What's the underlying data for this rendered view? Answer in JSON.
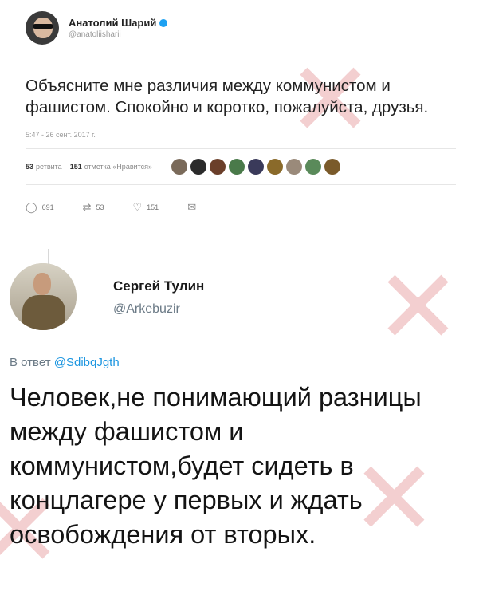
{
  "tweet1": {
    "author_name": "Анатолий Шарий",
    "handle": "@anatoliisharii",
    "text": "Объясните мне различия между коммунистом и фашистом. Спокойно и коротко, пожалуйста, друзья.",
    "timestamp": "5:47 - 26 сент. 2017 г.",
    "retweets_count": "53",
    "retweets_label": "ретвита",
    "likes_count": "151",
    "likes_label": "отметка «Нравится»",
    "actions": {
      "replies": "691",
      "retweets": "53",
      "likes": "151"
    },
    "liker_colors": [
      "#7a6a5a",
      "#2b2b2b",
      "#6b3f2a",
      "#4a7a4a",
      "#3a3a5a",
      "#8a6a2a",
      "#9a8a7a",
      "#5a8a5a",
      "#7a5a2a"
    ]
  },
  "tweet2": {
    "author_name": "Сергей Тулин",
    "handle": "@Arkebuzir",
    "reply_prefix": "В ответ",
    "reply_to": "@SdibqJgth",
    "text": "Человек,не понимающий разницы между фашистом и коммунистом,будет сидеть в концлагере у первых и ждать освобождения от вторых."
  }
}
